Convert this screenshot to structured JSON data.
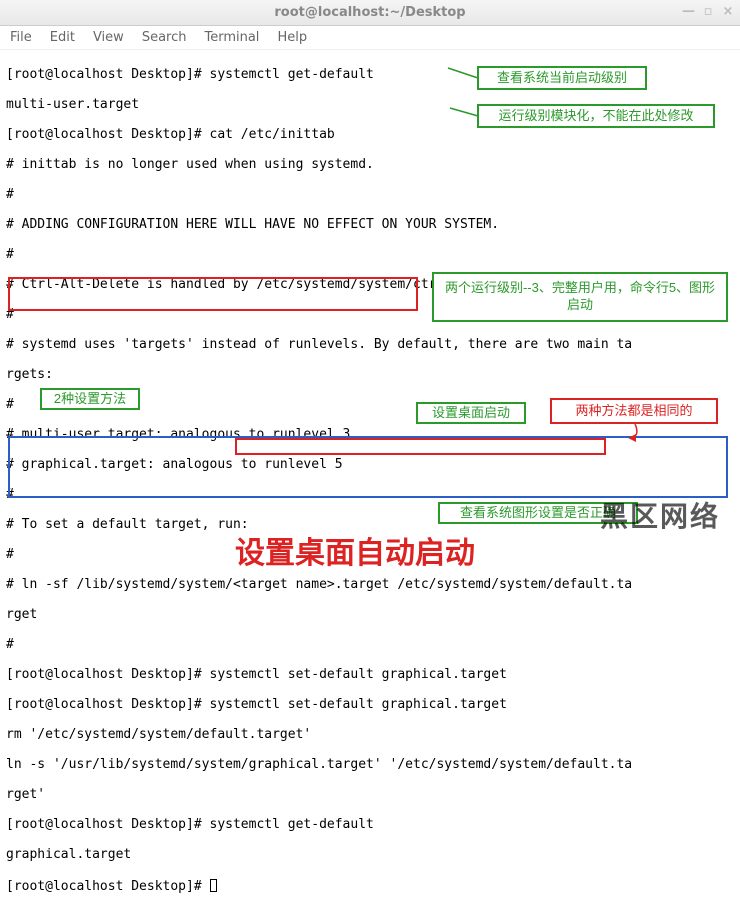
{
  "window": {
    "title": "root@localhost:~/Desktop",
    "controls": {
      "min": "—",
      "max": "▫",
      "close": "×"
    }
  },
  "menu": {
    "file": "File",
    "edit": "Edit",
    "view": "View",
    "search": "Search",
    "terminal": "Terminal",
    "help": "Help"
  },
  "terminal": {
    "line01": "[root@localhost Desktop]# systemctl get-default",
    "line02": "multi-user.target",
    "line03": "[root@localhost Desktop]# cat /etc/inittab",
    "line04": "# inittab is no longer used when using systemd.",
    "line05": "#",
    "line06": "# ADDING CONFIGURATION HERE WILL HAVE NO EFFECT ON YOUR SYSTEM.",
    "line07": "#",
    "line08": "# Ctrl-Alt-Delete is handled by /etc/systemd/system/ctrl-alt-del.target",
    "line09": "#",
    "line10": "# systemd uses 'targets' instead of runlevels. By default, there are two main ta",
    "line11": "rgets:",
    "line12": "#",
    "line13": "# multi-user.target: analogous to runlevel 3",
    "line14": "# graphical.target: analogous to runlevel 5",
    "line15": "#",
    "line16": "# To set a default target, run:",
    "line17": "#",
    "line18": "# ln -sf /lib/systemd/system/<target name>.target /etc/systemd/system/default.ta",
    "line19": "rget",
    "line20": "#",
    "line21": "[root@localhost Desktop]# systemctl set-default graphical.target",
    "line22a": "[root@localhost Desktop]# ",
    "line22b": "systemctl set-default graphical.target",
    "line23": "rm '/etc/systemd/system/default.target'",
    "line24": "ln -s '/usr/lib/systemd/system/graphical.target' '/etc/systemd/system/default.ta",
    "line25": "rget'",
    "line26": "[root@localhost Desktop]# systemctl get-default",
    "line27": "graphical.target",
    "line28": "[root@localhost Desktop]# "
  },
  "annotations": {
    "a1": "查看系统当前启动级别",
    "a2": "运行级别模块化，不能在此处修改",
    "a3": "两个运行级别--3、完整用户用，命令行5、图形启动",
    "a4": "2种设置方法",
    "a5": "设置桌面启动",
    "a6": "两种方法都是相同的",
    "a7": "查看系统图形设置是否正确"
  },
  "big_text": "设置桌面自动启动",
  "watermark": "黑区网络"
}
